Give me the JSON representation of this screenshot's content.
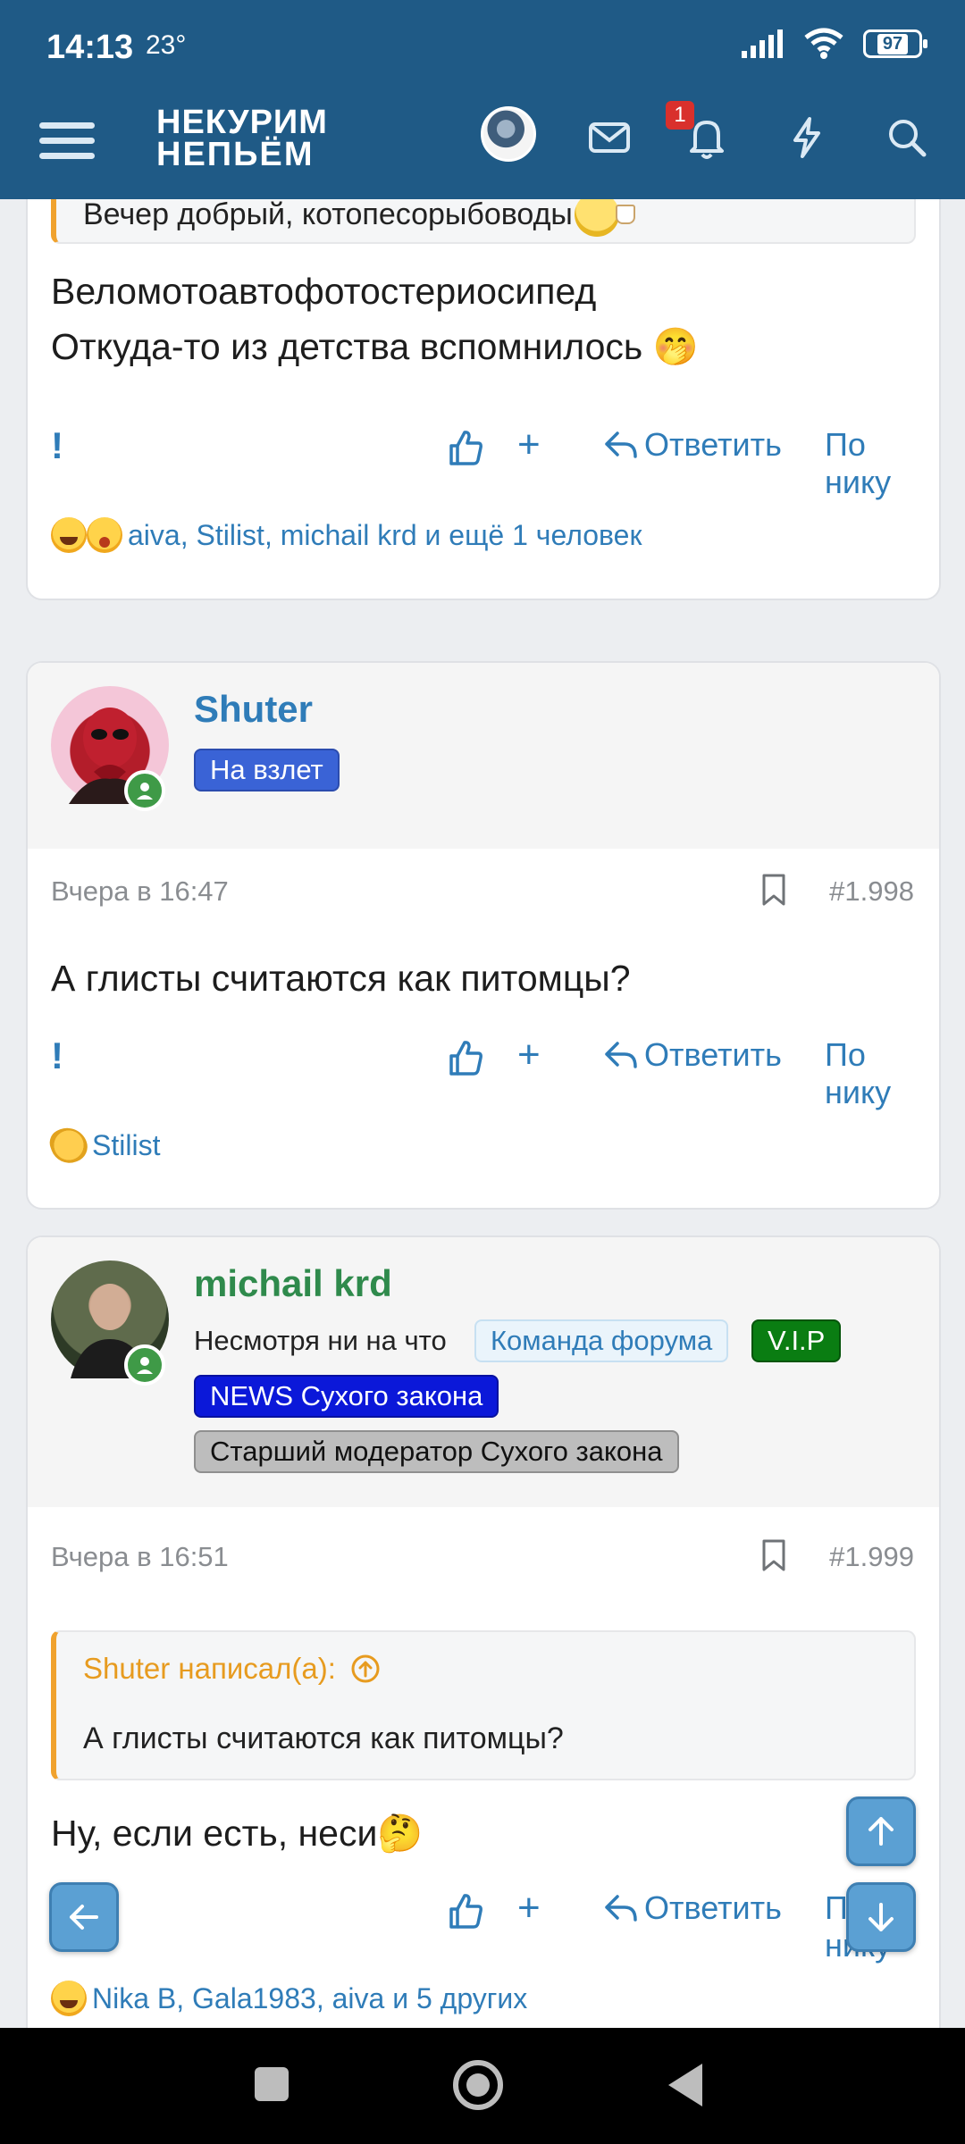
{
  "status_bar": {
    "time": "14:13",
    "temp": "23°",
    "battery": "97"
  },
  "header": {
    "logo_line1": "НЕКУРИМ",
    "logo_line2": "НЕПЬЁМ",
    "notification_count": "1"
  },
  "top_post": {
    "quote_text": "Вечер добрый, котопесорыбоводы",
    "text_line1": "Веломотоавтофотостериосипед",
    "text_line2": "Откуда-то из детства вспомнилось 🤭",
    "reactions_text": "aiva, Stilist, michail krd и ещё 1 человек"
  },
  "actions": {
    "report": "!",
    "plus": "+",
    "reply": "Ответить",
    "by_nick": "По нику"
  },
  "post_shuter": {
    "username": "Shuter",
    "rank_badge": "На взлет",
    "date": "Вчера в 16:47",
    "number": "#1.998",
    "text": "А глисты считаются как питомцы?",
    "reactions_text": "Stilist"
  },
  "post_michail": {
    "username": "michail krd",
    "status": "Несмотря ни на что",
    "badge_team": "Команда форума",
    "badge_vip": "V.I.P",
    "badge_news": "NEWS Сухого закона",
    "badge_moderator": "Старший модератор Сухого закона",
    "date": "Вчера в 16:51",
    "number": "#1.999",
    "quote_author": "Shuter написал(а):",
    "quote_text": "А глисты считаются как питомцы?",
    "text": "Ну, если есть, неси🤔",
    "reactions_text": "Nika B, Gala1983, aiva и 5 других"
  },
  "colors": {
    "header_bg": "#1f5a86",
    "link_blue": "#2f7cb8",
    "quote_accent": "#f0a22e",
    "username_green": "#2f8a4c",
    "vip_green": "#0a7d12",
    "news_blue": "#0b18d9"
  }
}
